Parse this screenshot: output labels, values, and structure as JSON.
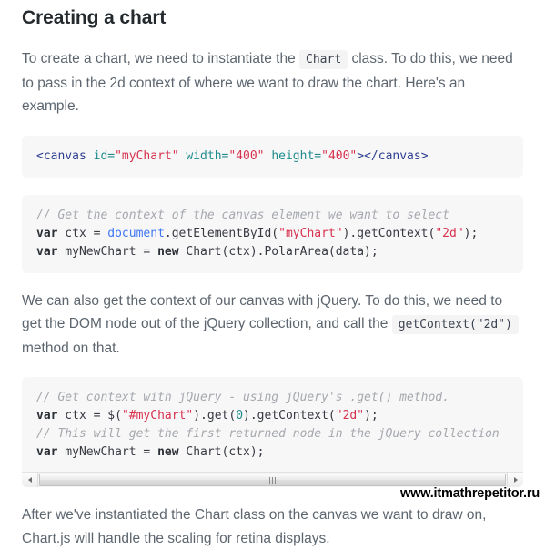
{
  "heading": "Creating a chart",
  "intro": {
    "before_chip": "To create a chart, we need to instantiate the",
    "chip": "Chart",
    "after_chip": "class. To do this, we need to pass in the 2d context of where we want to draw the chart. Here's an example."
  },
  "code_html": {
    "lines": [
      [
        {
          "text": "<canvas",
          "token": "tag"
        },
        {
          "text": " ",
          "token": "plain"
        },
        {
          "text": "id=",
          "token": "attr"
        },
        {
          "text": "\"myChart\"",
          "token": "string"
        },
        {
          "text": " ",
          "token": "plain"
        },
        {
          "text": "width=",
          "token": "attr"
        },
        {
          "text": "\"400\"",
          "token": "string"
        },
        {
          "text": " ",
          "token": "plain"
        },
        {
          "text": "height=",
          "token": "attr"
        },
        {
          "text": "\"400\"",
          "token": "string"
        },
        {
          "text": "></canvas>",
          "token": "tag"
        }
      ]
    ]
  },
  "code_js_basic": {
    "lines": [
      [
        {
          "text": "// Get the context of the canvas element we want to select",
          "token": "comment"
        }
      ],
      [
        {
          "text": "var",
          "token": "keyword"
        },
        {
          "text": " ctx = ",
          "token": "plain"
        },
        {
          "text": "document",
          "token": "builtin"
        },
        {
          "text": ".getElementById(",
          "token": "plain"
        },
        {
          "text": "\"myChart\"",
          "token": "string"
        },
        {
          "text": ").getContext(",
          "token": "plain"
        },
        {
          "text": "\"2d\"",
          "token": "string"
        },
        {
          "text": ");",
          "token": "plain"
        }
      ],
      [
        {
          "text": "var",
          "token": "keyword"
        },
        {
          "text": " myNewChart = ",
          "token": "plain"
        },
        {
          "text": "new",
          "token": "keyword"
        },
        {
          "text": " Chart(ctx).PolarArea(data);",
          "token": "plain"
        }
      ]
    ]
  },
  "jquery_para": {
    "before_chip": "We can also get the context of our canvas with jQuery. To do this, we need to get the DOM node out of the jQuery collection, and call the",
    "chip": "getContext(\"2d\")",
    "after_chip": "method on that."
  },
  "code_js_jquery": {
    "lines": [
      [
        {
          "text": "// Get context with jQuery - using jQuery's .get() method.",
          "token": "comment"
        }
      ],
      [
        {
          "text": "var",
          "token": "keyword"
        },
        {
          "text": " ctx = $(",
          "token": "plain"
        },
        {
          "text": "\"#myChart\"",
          "token": "string"
        },
        {
          "text": ").get(",
          "token": "plain"
        },
        {
          "text": "0",
          "token": "number"
        },
        {
          "text": ").getContext(",
          "token": "plain"
        },
        {
          "text": "\"2d\"",
          "token": "string"
        },
        {
          "text": ");",
          "token": "plain"
        }
      ],
      [
        {
          "text": "// This will get the first returned node in the jQuery collection",
          "token": "comment"
        }
      ],
      [
        {
          "text": "var",
          "token": "keyword"
        },
        {
          "text": " myNewChart = ",
          "token": "plain"
        },
        {
          "text": "new",
          "token": "keyword"
        },
        {
          "text": " Chart(ctx);",
          "token": "plain"
        }
      ]
    ],
    "scrollbar": {
      "left_arrow": "arrow-left-icon",
      "right_arrow": "arrow-right-icon"
    }
  },
  "closing_para": "After we've instantiated the Chart class on the canvas we want to draw on, Chart.js will handle the scaling for retina displays.",
  "watermark": "www.itmathrepetitor.ru",
  "colors": {
    "heading": "#24292e",
    "body_text": "#5d666f",
    "code_bg": "#f7f7f8",
    "chip_bg": "#f4f4f5",
    "tag": "#2c3e8f",
    "attr": "#1f8b8b",
    "string": "#d7314e",
    "comment": "#a5a8ad",
    "keyword": "#2b2f36",
    "builtin": "#4078f2",
    "number": "#1f8b8b"
  }
}
